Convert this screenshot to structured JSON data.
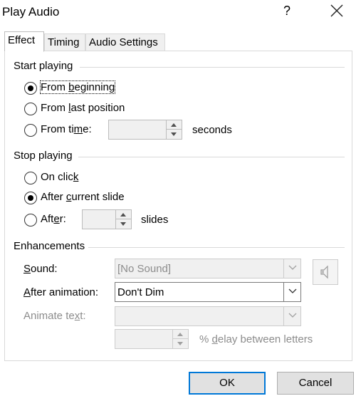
{
  "window": {
    "title": "Play Audio",
    "help": "?"
  },
  "tabs": [
    {
      "label": "Effect",
      "active": true
    },
    {
      "label": "Timing",
      "active": false
    },
    {
      "label": "Audio Settings",
      "active": false
    }
  ],
  "start_playing": {
    "legend": "Start playing",
    "options": {
      "from_beginning": {
        "pre": "From ",
        "key": "b",
        "post": "eginning",
        "selected": true
      },
      "from_last": {
        "pre": "From ",
        "key": "l",
        "post": "ast position",
        "selected": false
      },
      "from_time": {
        "pre": "From ti",
        "key": "m",
        "post": "e:",
        "selected": false
      }
    },
    "time_value": "",
    "time_unit": "seconds"
  },
  "stop_playing": {
    "legend": "Stop playing",
    "options": {
      "on_click": {
        "pre": "On clic",
        "key": "k",
        "post": "",
        "selected": false
      },
      "after_current": {
        "pre": "After ",
        "key": "c",
        "post": "urrent slide",
        "selected": true
      },
      "after": {
        "pre": "Aft",
        "key": "e",
        "post": "r:",
        "selected": false
      }
    },
    "after_value": "",
    "after_unit": "slides"
  },
  "enhancements": {
    "legend": "Enhancements",
    "sound": {
      "pre": "",
      "key": "S",
      "post": "ound:",
      "value": "[No Sound]"
    },
    "after_animation": {
      "pre": "",
      "key": "A",
      "post": "fter animation:",
      "value": "Don't Dim"
    },
    "animate_text": {
      "pre": "Animate te",
      "key": "x",
      "post": "t:",
      "value": ""
    },
    "delay_value": "",
    "delay_label": {
      "pre": "% ",
      "key": "d",
      "post": "elay between letters"
    }
  },
  "buttons": {
    "ok": "OK",
    "cancel": "Cancel"
  },
  "colors": {
    "accent": "#0078d7",
    "disabled_text": "#8c8c8c",
    "disabled_bg": "#f0f0f0"
  },
  "icons": [
    "close-icon",
    "speaker-icon",
    "chevron-down-icon",
    "spin-up-icon",
    "spin-down-icon"
  ]
}
